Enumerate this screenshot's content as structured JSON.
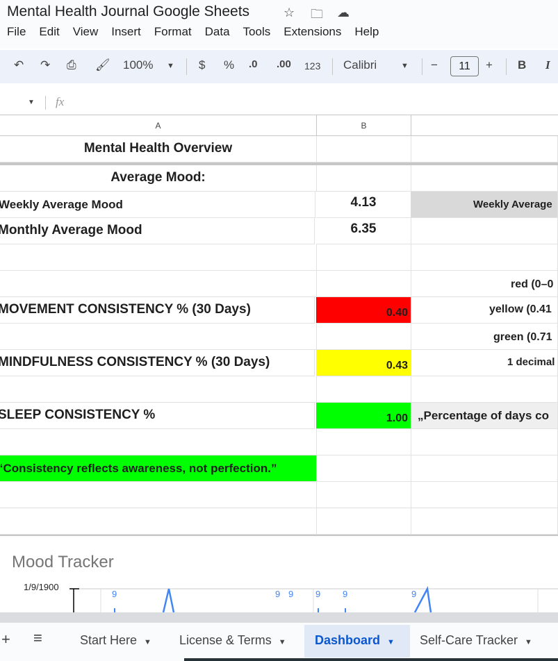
{
  "app": {
    "title": "Mental Health Journal Google Sheets",
    "menu": [
      "File",
      "Edit",
      "View",
      "Insert",
      "Format",
      "Data",
      "Tools",
      "Extensions",
      "Help"
    ]
  },
  "toolbar": {
    "zoom": "100%",
    "currency": "$",
    "percent": "%",
    "dec_decrease": ".0",
    "dec_increase": ".00",
    "number_format": "123",
    "font": "Calibri",
    "font_size": "11",
    "minus": "−",
    "plus": "+",
    "bold": "B",
    "italic": "I"
  },
  "formula_bar": {
    "fx": "fx",
    "value": ""
  },
  "columns": [
    "A",
    "B"
  ],
  "cells": {
    "title": "Mental Health Overview",
    "avg_mood_label": "Average Mood:",
    "weekly_label": "Weekly Average Mood",
    "weekly_value": "4.13",
    "weekly_note": "Weekly Average",
    "monthly_label": "Monthly Average Mood",
    "monthly_value": "6.35",
    "legend_red": "red (0–0",
    "legend_yellow": "yellow (0.41",
    "legend_green": "green (0.71",
    "legend_decimal": "1 decimal",
    "movement_label": "MOVEMENT CONSISTENCY % (30 Days)",
    "movement_value": "0.40",
    "mindfulness_label": "MINDFULNESS CONSISTENCY % (30 Days)",
    "mindfulness_value": "0.43",
    "sleep_label": "SLEEP CONSISTENCY %",
    "sleep_value": "1.00",
    "sleep_note": "„Percentage of days co",
    "quote": "“Consistency reflects awareness, not perfection.”"
  },
  "colors": {
    "red": "#ff0000",
    "yellow": "#ffff00",
    "green": "#00ff00",
    "note_gray": "#d9d9d9",
    "accent": "#0b57d0"
  },
  "chart_data": {
    "type": "line",
    "title": "Mood Tracker",
    "y_ticks": [
      "1/9/1900"
    ],
    "data_labels": [
      "9",
      "9",
      "9",
      "9",
      "9",
      "9"
    ]
  },
  "sheet_tabs": [
    {
      "label": "Start Here",
      "active": false
    },
    {
      "label": "License & Terms",
      "active": false
    },
    {
      "label": "Dashboard",
      "active": true
    },
    {
      "label": "Self-Care Tracker",
      "active": false
    }
  ],
  "tab_controls": {
    "add": "+",
    "list": "≡"
  }
}
